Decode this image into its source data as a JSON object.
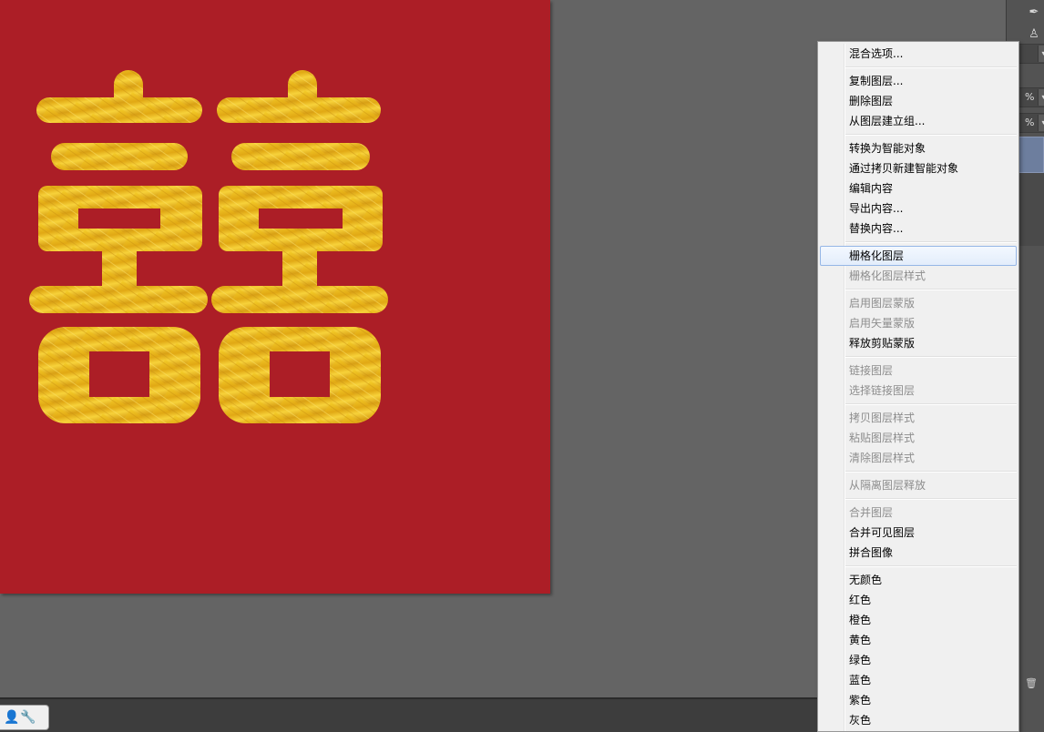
{
  "canvas": {
    "background_color": "#ac1e26",
    "artwork": "gold-foil double-happiness character",
    "character": "囍"
  },
  "context_menu": {
    "groups": [
      [
        {
          "label": "混合选项...",
          "disabled": false
        }
      ],
      [
        {
          "label": "复制图层...",
          "disabled": false
        },
        {
          "label": "删除图层",
          "disabled": false
        },
        {
          "label": "从图层建立组...",
          "disabled": false
        }
      ],
      [
        {
          "label": "转换为智能对象",
          "disabled": false
        },
        {
          "label": "通过拷贝新建智能对象",
          "disabled": false
        },
        {
          "label": "编辑内容",
          "disabled": false
        },
        {
          "label": "导出内容...",
          "disabled": false
        },
        {
          "label": "替换内容...",
          "disabled": false
        }
      ],
      [
        {
          "label": "栅格化图层",
          "disabled": false,
          "highlighted": true
        },
        {
          "label": "栅格化图层样式",
          "disabled": true
        }
      ],
      [
        {
          "label": "启用图层蒙版",
          "disabled": true
        },
        {
          "label": "启用矢量蒙版",
          "disabled": true
        },
        {
          "label": "释放剪贴蒙版",
          "disabled": false
        }
      ],
      [
        {
          "label": "链接图层",
          "disabled": true
        },
        {
          "label": "选择链接图层",
          "disabled": true
        }
      ],
      [
        {
          "label": "拷贝图层样式",
          "disabled": true
        },
        {
          "label": "粘贴图层样式",
          "disabled": true
        },
        {
          "label": "清除图层样式",
          "disabled": true
        }
      ],
      [
        {
          "label": "从隔离图层释放",
          "disabled": true
        }
      ],
      [
        {
          "label": "合并图层",
          "disabled": true
        },
        {
          "label": "合并可见图层",
          "disabled": false
        },
        {
          "label": "拼合图像",
          "disabled": false
        }
      ],
      [
        {
          "label": "无颜色",
          "disabled": false
        },
        {
          "label": "红色",
          "disabled": false
        },
        {
          "label": "橙色",
          "disabled": false
        },
        {
          "label": "黄色",
          "disabled": false
        },
        {
          "label": "绿色",
          "disabled": false
        },
        {
          "label": "蓝色",
          "disabled": false
        },
        {
          "label": "紫色",
          "disabled": false
        },
        {
          "label": "灰色",
          "disabled": false
        }
      ]
    ]
  },
  "right_panel": {
    "tool_icons": [
      "brush-icon",
      "stamp-icon"
    ],
    "opacity_suffix": "%",
    "fill_suffix": "%",
    "trash_icon": "trash-icon"
  },
  "status_bar": {
    "icons": [
      "user-icon",
      "wrench-icon"
    ]
  },
  "colors": {
    "workspace_bg": "#646464",
    "menu_bg": "#f0f0f0",
    "menu_highlight_border": "#95b6e6",
    "gold": "#e9b81d"
  }
}
